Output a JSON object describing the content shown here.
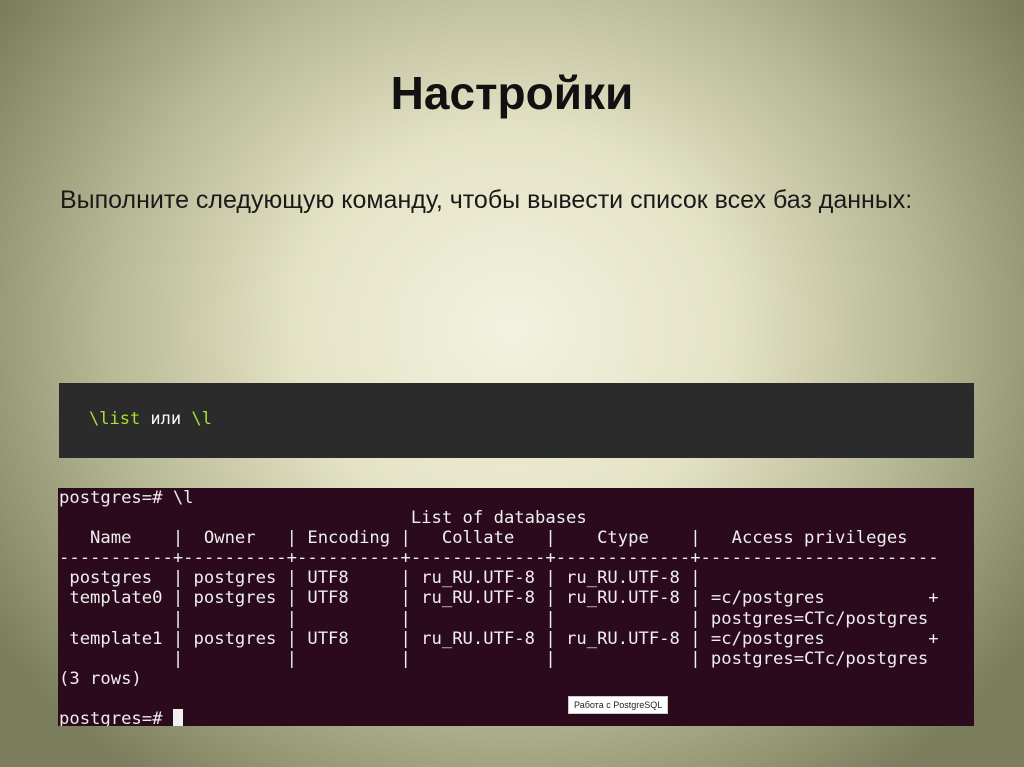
{
  "slide": {
    "title": "Настройки",
    "subtitle": "Выполните следующую команду, чтобы вывести список всех баз данных:"
  },
  "code": {
    "cmd1": "\\list",
    "or": " или ",
    "cmd2": "\\l"
  },
  "terminal": {
    "lines": [
      "postgres=# \\l",
      "                                  List of databases",
      "   Name    |  Owner   | Encoding |   Collate   |    Ctype    |   Access privileges",
      "-----------+----------+----------+-------------+-------------+-----------------------",
      " postgres  | postgres | UTF8     | ru_RU.UTF-8 | ru_RU.UTF-8 |",
      " template0 | postgres | UTF8     | ru_RU.UTF-8 | ru_RU.UTF-8 | =c/postgres          +",
      "           |          |          |             |             | postgres=CTc/postgres",
      " template1 | postgres | UTF8     | ru_RU.UTF-8 | ru_RU.UTF-8 | =c/postgres          +",
      "           |          |          |             |             | postgres=CTc/postgres",
      "(3 rows)",
      "",
      "postgres=# "
    ],
    "tooltip": "Работа с PostgreSQL"
  }
}
